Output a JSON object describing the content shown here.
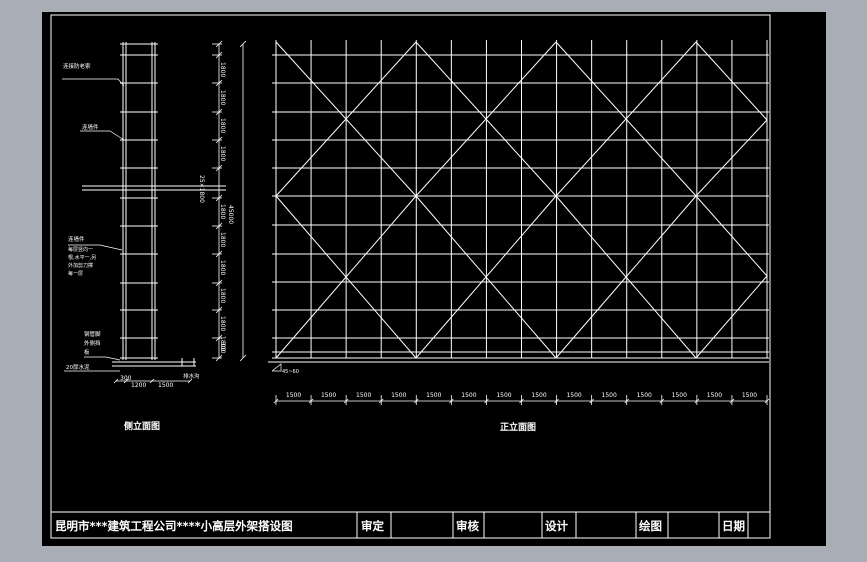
{
  "colors": {
    "background_outer": "#a9adb5",
    "paper": "#000000",
    "lines": "#ffffff"
  },
  "side_elevation": {
    "title": "侧立面图",
    "labels": {
      "safety_net": "连接防老索",
      "wall_tie": "连墙件",
      "wall_tie_note_1": "连墙件",
      "wall_tie_note_2": "每层竖向一",
      "wall_tie_note_3": "根,水平一,另",
      "wall_tie_note_4": "外加剪刀撑",
      "wall_tie_note_5": "每一层",
      "floor_note_1": "钢管脚",
      "floor_note_2": "外侧挡",
      "floor_note_3": "板",
      "ground": "20厚水泥",
      "drain": "排水沟"
    },
    "dims_right": [
      "1800",
      "1800",
      "1800",
      "1800",
      "1800",
      "1800",
      "1800",
      "1800",
      "1800",
      "1800",
      "300"
    ],
    "dim_total_inner": "25×1800",
    "dim_total_outer": "45000",
    "dims_bottom": [
      "300",
      "1200",
      "1500"
    ]
  },
  "front_elevation": {
    "title": "正立面图",
    "angle_note": "45~60",
    "bays": [
      "1500",
      "1500",
      "1500",
      "1500",
      "1500",
      "1500",
      "1500",
      "1500",
      "1500",
      "1500",
      "1500",
      "1500",
      "1500",
      "1500"
    ]
  },
  "title_block": {
    "project": "昆明市***建筑工程公司****小高层外架搭设图",
    "approve": "审定",
    "review": "审核",
    "design": "设计",
    "draw": "绘图",
    "date": "日期"
  }
}
